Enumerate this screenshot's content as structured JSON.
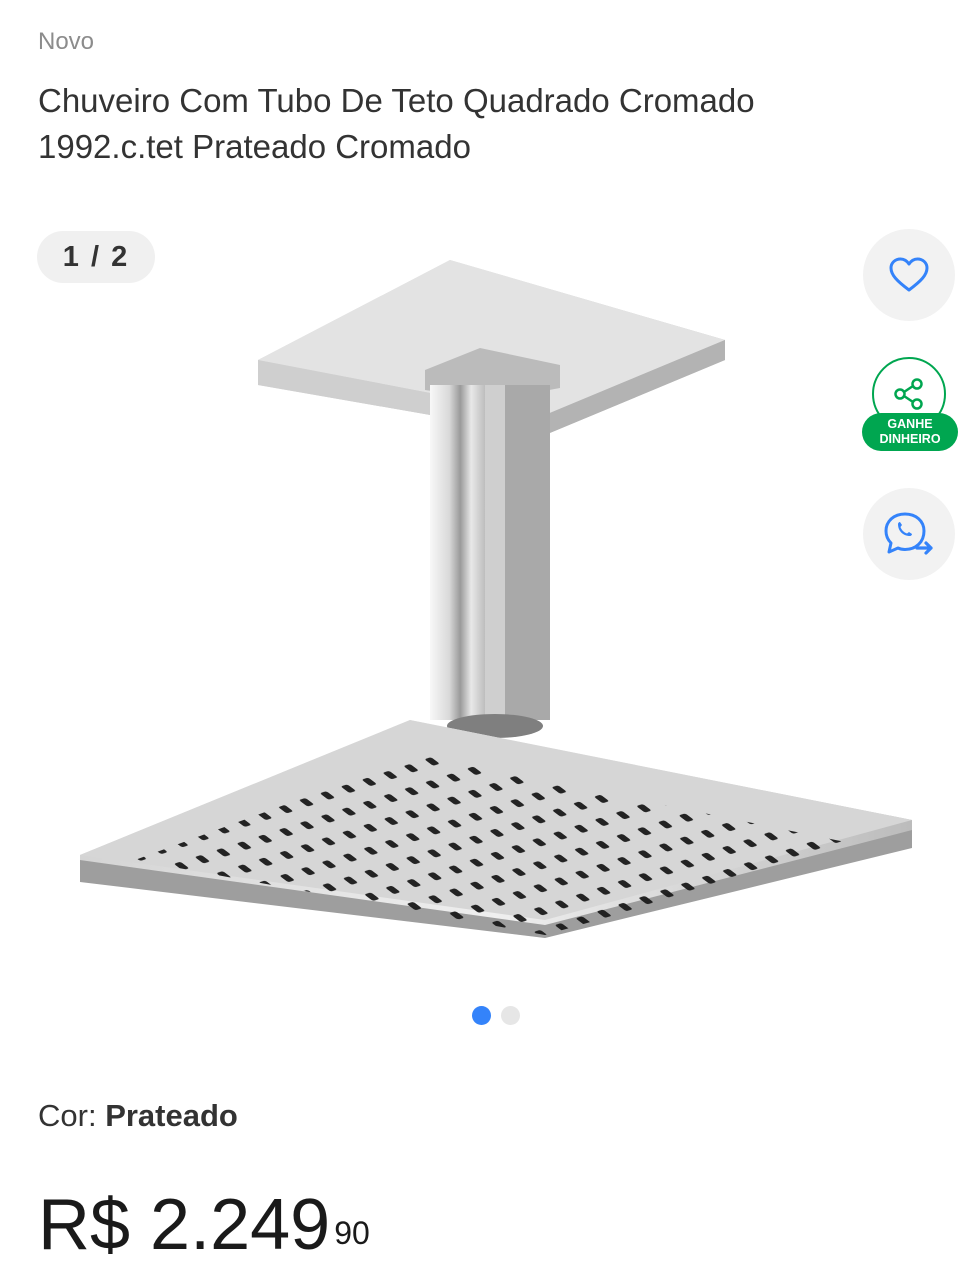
{
  "product": {
    "condition": "Novo",
    "title": "Chuveiro Com Tubo De Teto Quadrado Cromado 1992.c.tet Prateado Cromado"
  },
  "gallery": {
    "counter": "1 / 2",
    "image_alt": "shower head chrome product photo",
    "dots_total": 2,
    "dots_active": 1
  },
  "actions": {
    "favorite_icon": "heart-icon",
    "share_icon": "share-icon",
    "share_badge": "GANHE DINHEIRO",
    "whatsapp_icon": "whatsapp-icon"
  },
  "variant": {
    "label": "Cor: ",
    "value": "Prateado"
  },
  "price": {
    "main": "R$ 2.249",
    "cents": "90"
  },
  "colors": {
    "accent_blue": "#3483fa",
    "green": "#00a650"
  }
}
